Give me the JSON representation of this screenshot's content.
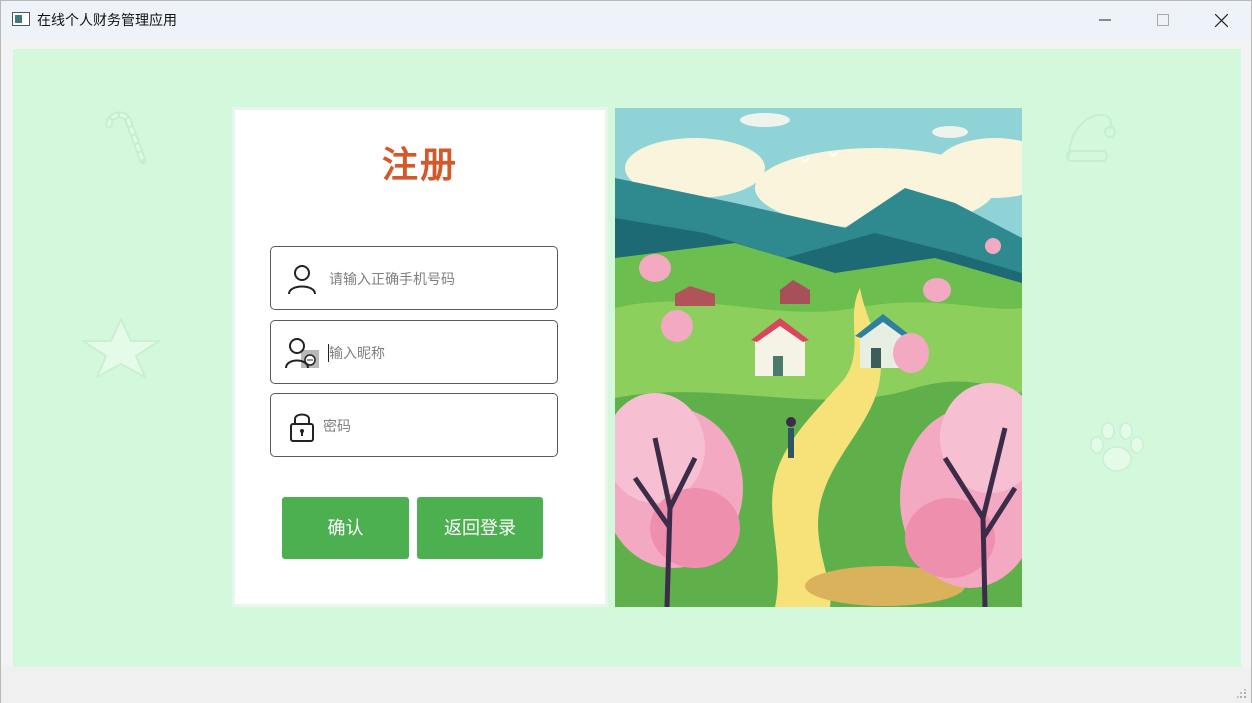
{
  "window": {
    "title": "在线个人财务管理应用",
    "controls": {
      "minimize": "minimize",
      "maximize": "maximize",
      "close": "close"
    }
  },
  "form": {
    "heading": "注册",
    "phone_placeholder": "请输入正确手机号码",
    "nickname_placeholder": "输入昵称",
    "password_placeholder": "密码",
    "confirm_label": "确认",
    "back_label": "返回登录"
  },
  "icons": {
    "user": "user-icon",
    "nickname": "nickname-icon",
    "lock": "lock-icon",
    "background": [
      "candy-cane-icon",
      "star-icon",
      "santa-hat-icon",
      "paw-icon"
    ]
  },
  "colors": {
    "background": "#d3f8dc",
    "heading": "#d4582a",
    "button": "#4caf50"
  }
}
